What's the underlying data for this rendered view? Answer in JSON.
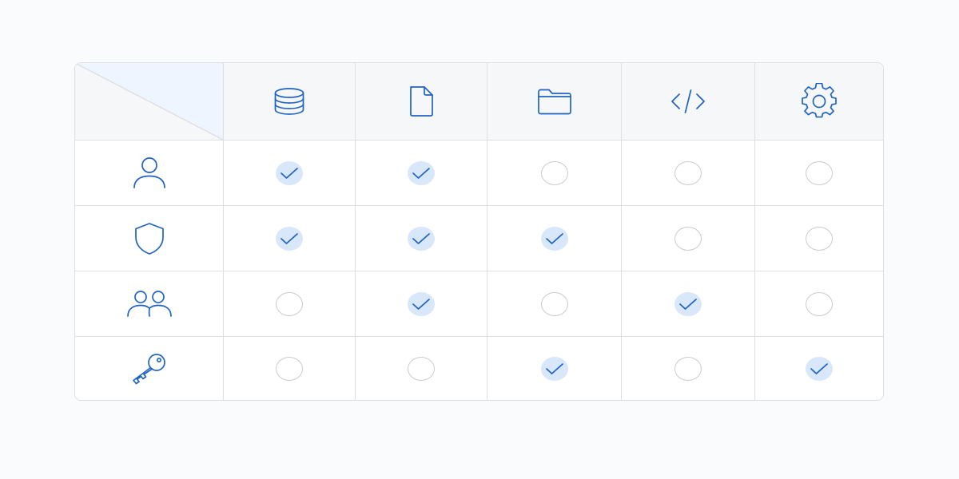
{
  "colors": {
    "accent": "#1f63c2",
    "checked_fill": "#d9e7fb",
    "grid_line": "#dcdfe5",
    "header_bg": "#f6f7f9",
    "corner_tint": "#eef5ff"
  },
  "columns": [
    {
      "icon": "database-icon"
    },
    {
      "icon": "file-icon"
    },
    {
      "icon": "folder-icon"
    },
    {
      "icon": "code-icon"
    },
    {
      "icon": "gear-icon"
    }
  ],
  "rows": [
    {
      "icon": "user-icon",
      "checked": [
        true,
        true,
        false,
        false,
        false
      ]
    },
    {
      "icon": "shield-icon",
      "checked": [
        true,
        true,
        true,
        false,
        false
      ]
    },
    {
      "icon": "group-icon",
      "checked": [
        false,
        true,
        false,
        true,
        false
      ]
    },
    {
      "icon": "key-icon",
      "checked": [
        false,
        false,
        true,
        false,
        true
      ]
    }
  ]
}
